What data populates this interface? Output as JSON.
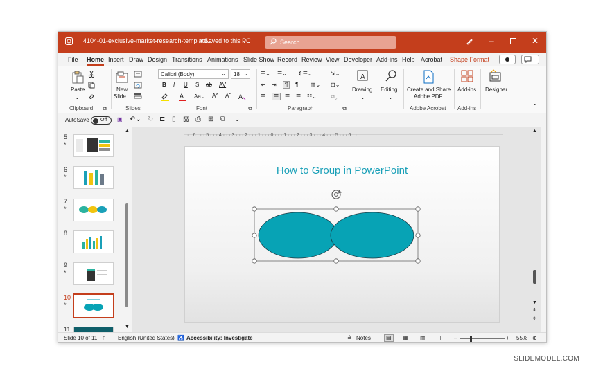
{
  "titlebar": {
    "filename": "4104-01-exclusive-market-research-template...",
    "saved_status": "• Saved to this PC",
    "search_placeholder": "Search",
    "color": "#c43e1c"
  },
  "menu": {
    "items": [
      "File",
      "Home",
      "Insert",
      "Draw",
      "Design",
      "Transitions",
      "Animations",
      "Slide Show",
      "Record",
      "Review",
      "View",
      "Developer",
      "Add-ins",
      "Help",
      "Acrobat",
      "Shape Format"
    ],
    "active": "Home"
  },
  "ribbon": {
    "clipboard": {
      "paste": "Paste",
      "label": "Clipboard"
    },
    "slides": {
      "new_slide_1": "New",
      "new_slide_2": "Slide",
      "label": "Slides"
    },
    "font": {
      "name": "Calibri (Body)",
      "size": "18",
      "label": "Font"
    },
    "paragraph": {
      "label": "Paragraph"
    },
    "drawing": "Drawing",
    "editing": "Editing",
    "adobe": {
      "line1": "Create and Share",
      "line2": "Adobe PDF",
      "label": "Adobe Acrobat"
    },
    "addins": {
      "button": "Add-ins",
      "label": "Add-ins"
    },
    "designer": "Designer"
  },
  "qat": {
    "autosave": "AutoSave",
    "toggle": "Off"
  },
  "thumbnails": [
    {
      "num": "5",
      "star": "*"
    },
    {
      "num": "6",
      "star": "*"
    },
    {
      "num": "7",
      "star": "*"
    },
    {
      "num": "8",
      "star": ""
    },
    {
      "num": "9",
      "star": "*"
    },
    {
      "num": "10",
      "star": "*"
    },
    {
      "num": "11",
      "star": ""
    }
  ],
  "slide": {
    "title": "How to Group in PowerPoint",
    "shape_fill": "#07a3b5"
  },
  "status": {
    "slide_of": "Slide 10 of 11",
    "language": "English (United States)",
    "accessibility": "Accessibility: Investigate",
    "notes": "Notes",
    "zoom": "55%"
  },
  "watermark": "SLIDEMODEL.COM"
}
